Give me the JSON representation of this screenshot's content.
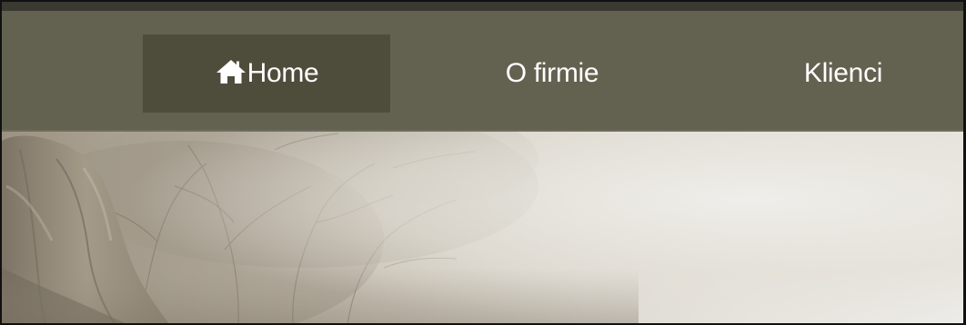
{
  "nav": {
    "items": [
      {
        "label": "Home",
        "icon": "home-icon",
        "active": true
      },
      {
        "label": "O firmie",
        "active": false
      },
      {
        "label": "Klienci",
        "active": false
      }
    ]
  },
  "hero": {
    "image": "misty-forest-with-rock-formation",
    "alt": ""
  },
  "colors": {
    "navbar_bg": "#636250",
    "active_item_bg": "#4e4c3b",
    "nav_text": "#ffffff"
  }
}
